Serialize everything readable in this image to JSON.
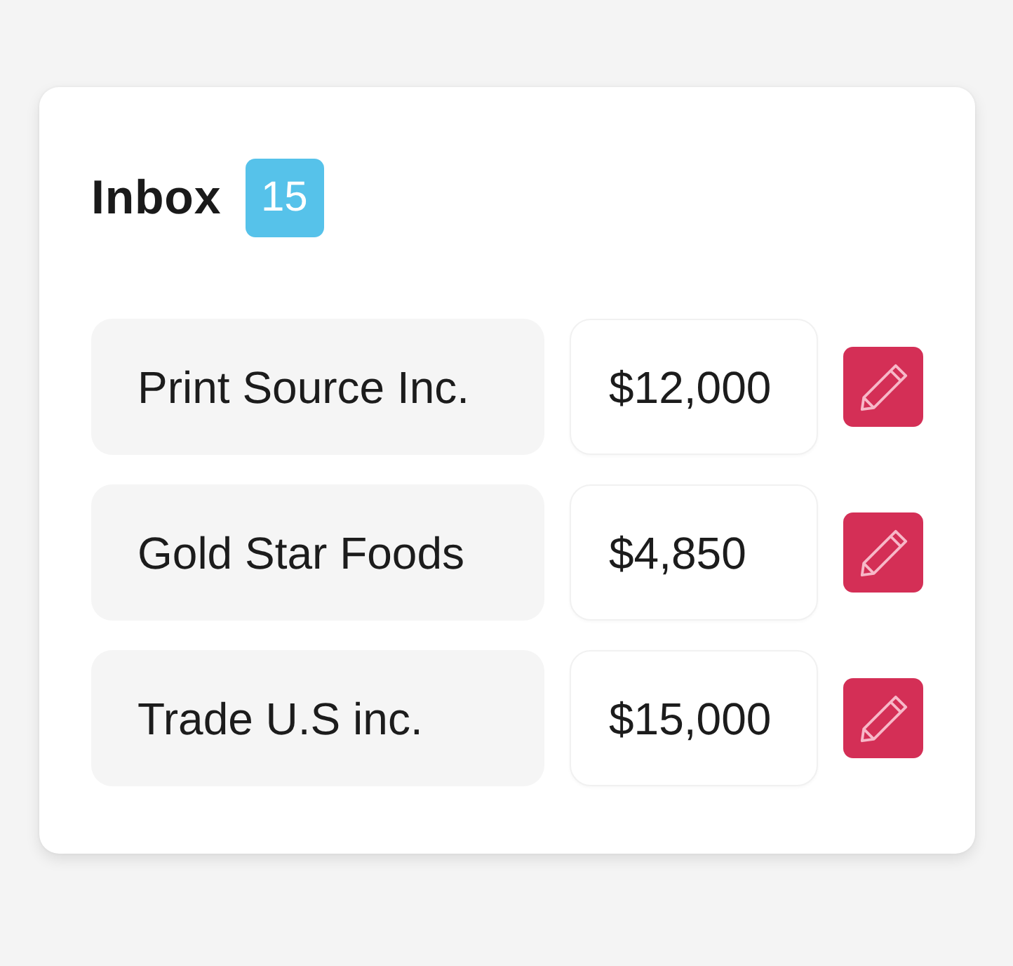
{
  "inbox": {
    "title": "Inbox",
    "count": "15"
  },
  "rows": [
    {
      "name": "Print Source Inc.",
      "amount": "$12,000"
    },
    {
      "name": "Gold Star Foods",
      "amount": "$4,850"
    },
    {
      "name": "Trade U.S inc.",
      "amount": "$15,000"
    }
  ]
}
